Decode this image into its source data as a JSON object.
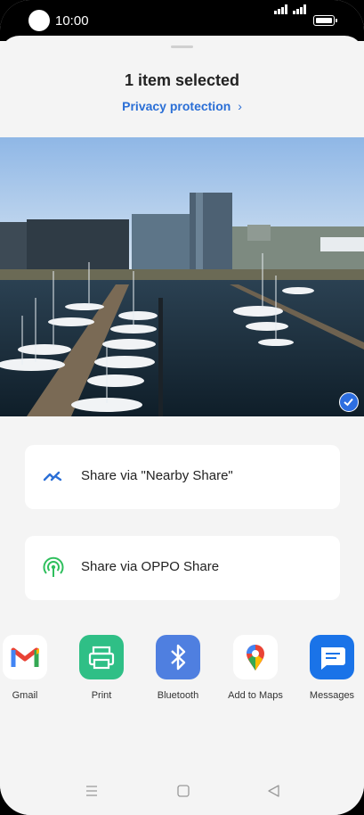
{
  "status": {
    "time": "10:00"
  },
  "sheet": {
    "title": "1 item selected",
    "privacy_link": "Privacy protection",
    "chevron_glyph": "›"
  },
  "share_options": [
    {
      "label": "Share via \"Nearby Share\"",
      "icon": "nearby-share-icon"
    },
    {
      "label": "Share via OPPO Share",
      "icon": "oppo-share-icon"
    }
  ],
  "apps": [
    {
      "name": "Gmail",
      "icon": "gmail-icon"
    },
    {
      "name": "Print",
      "icon": "print-icon"
    },
    {
      "name": "Bluetooth",
      "icon": "bluetooth-icon"
    },
    {
      "name": "Add to Maps",
      "icon": "maps-icon"
    },
    {
      "name": "Messages",
      "icon": "messages-icon"
    }
  ],
  "colors": {
    "accent": "#2b6fd6",
    "print": "#2fbf86",
    "bluetooth": "#4f7fe0",
    "messages": "#1a73e8"
  }
}
